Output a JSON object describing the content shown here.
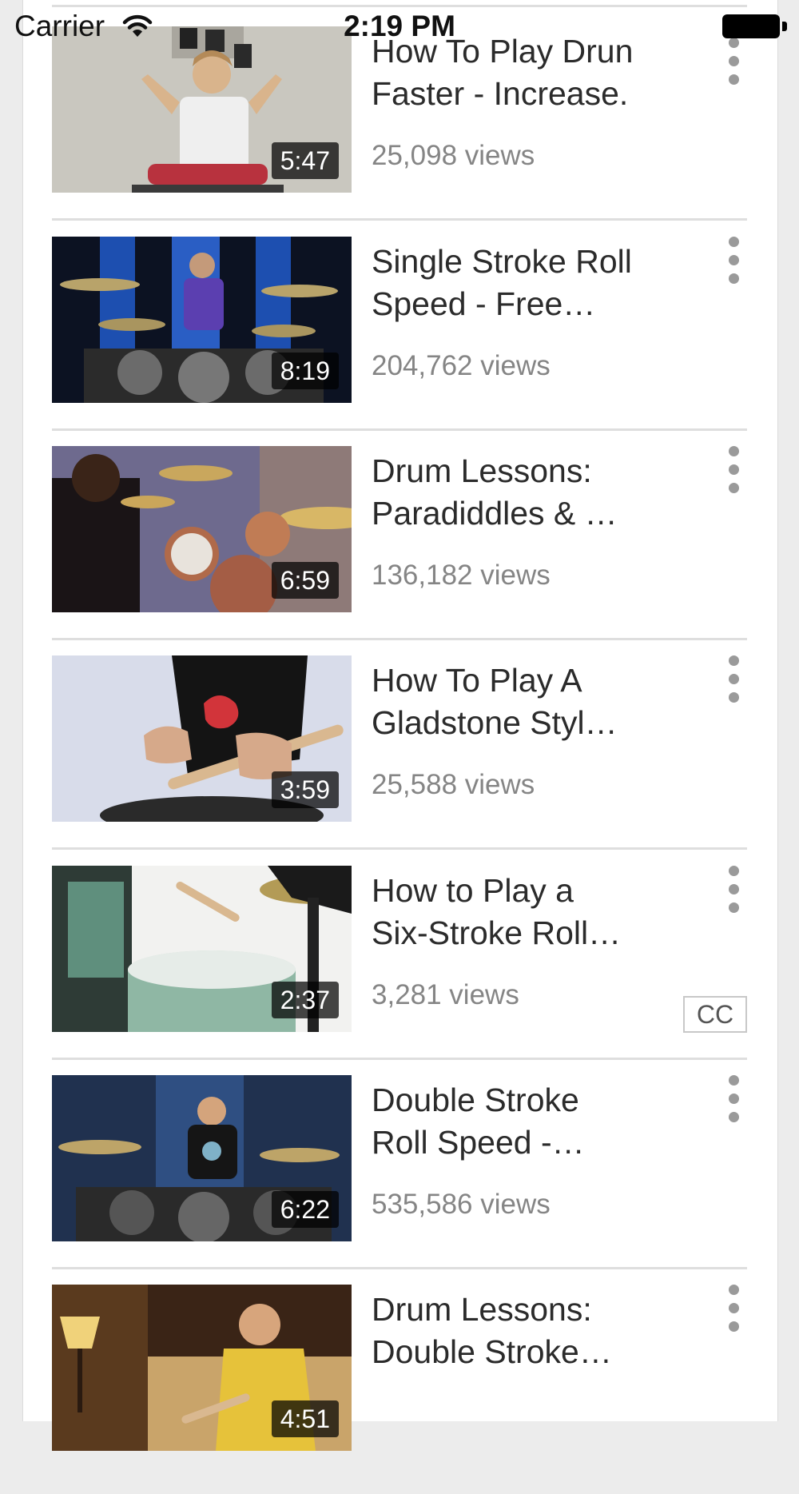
{
  "status_bar": {
    "carrier": "Carrier",
    "time": "2:19 PM",
    "battery_level": 1.0
  },
  "videos": [
    {
      "title_line1": "How To Play Drun",
      "title_line2": "Faster - Increase.",
      "views": "25,098 views",
      "duration": "5:47",
      "cc": ""
    },
    {
      "title_line1": "Single Stroke Roll",
      "title_line2": "Speed - Free…",
      "views": "204,762 views",
      "duration": "8:19",
      "cc": ""
    },
    {
      "title_line1": "Drum Lessons:",
      "title_line2": "Paradiddles & …",
      "views": "136,182 views",
      "duration": "6:59",
      "cc": ""
    },
    {
      "title_line1": "How To Play A",
      "title_line2": "Gladstone Styl…",
      "views": "25,588 views",
      "duration": "3:59",
      "cc": ""
    },
    {
      "title_line1": "How to Play a",
      "title_line2": "Six-Stroke Roll…",
      "views": "3,281 views",
      "duration": "2:37",
      "cc": "CC"
    },
    {
      "title_line1": "Double Stroke",
      "title_line2": "Roll Speed -…",
      "views": "535,586 views",
      "duration": "6:22",
      "cc": ""
    },
    {
      "title_line1": "Drum Lessons:",
      "title_line2": "Double Stroke…",
      "views": "",
      "duration": "4:51",
      "cc": ""
    }
  ],
  "colors": {
    "divider": "#dedede",
    "title": "#2b2b2b",
    "views": "#858585",
    "background": "#ececec",
    "card": "#ffffff"
  }
}
